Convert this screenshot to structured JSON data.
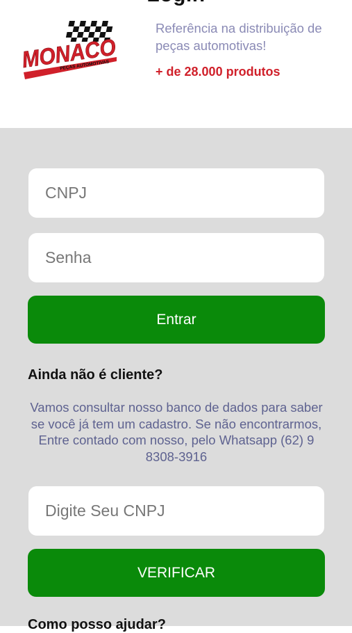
{
  "header": {
    "page_title": "Login",
    "logo": {
      "brand": "MONACO",
      "subtitle": "PEÇAS AUTOMOTIVAS"
    },
    "tagline": "Referência na distribuição de peças automotivas!",
    "products_count": "+ de 28.000 produtos"
  },
  "login": {
    "cnpj_placeholder": "CNPJ",
    "password_placeholder": "Senha",
    "submit_label": "Entrar"
  },
  "signup": {
    "heading": "Ainda não é cliente?",
    "info": "Vamos consultar nosso banco de dados para saber se você já tem um cadastro. Se não encontrarmos, Entre contado com nosso, pelo Whatsapp (62) 9 8308-3916",
    "cnpj_placeholder": "Digite Seu CNPJ",
    "verify_label": "VERIFICAR"
  },
  "help": {
    "heading": "Como posso ajudar?"
  },
  "colors": {
    "brand_red": "#d0202a",
    "button_green": "#0a8a0a",
    "background_grey": "#dcdcdc",
    "tagline_text": "#8a8ab5",
    "info_text": "#5e6290"
  }
}
